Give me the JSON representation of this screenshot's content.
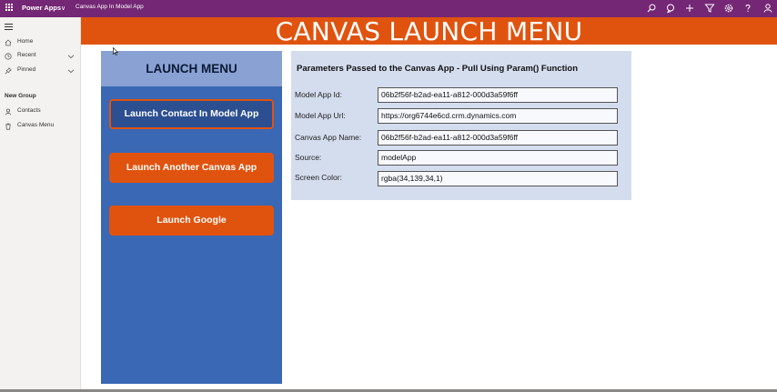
{
  "topbar": {
    "brand": "Power Apps",
    "app_name": "Canvas App In Model App",
    "icons": [
      "waffle-icon",
      "chevron-down-icon",
      "search-icon",
      "lightbulb-icon",
      "plus-icon",
      "filter-icon",
      "settings-icon",
      "help-icon",
      "person-icon"
    ]
  },
  "leftnav": {
    "items": [
      {
        "label": "Home",
        "icon": "home-icon"
      },
      {
        "label": "Recent",
        "icon": "clock-icon"
      },
      {
        "label": "Pinned",
        "icon": "pin-icon"
      }
    ],
    "group_label": "New Group",
    "group_items": [
      {
        "label": "Contacts",
        "icon": "person-icon"
      },
      {
        "label": "Canvas Menu",
        "icon": "trash-icon"
      }
    ]
  },
  "banner": {
    "title": "CANVAS LAUNCH MENU"
  },
  "launch_menu": {
    "title": "LAUNCH MENU",
    "buttons": [
      {
        "label": "Launch Contact In Model App"
      },
      {
        "label": "Launch Another Canvas App"
      },
      {
        "label": "Launch Google"
      }
    ]
  },
  "parameters": {
    "title": "Parameters Passed to the Canvas App - Pull Using Param() Function",
    "rows": [
      {
        "label": "Model App Id:",
        "value": "06b2f56f-b2ad-ea11-a812-000d3a59f6ff"
      },
      {
        "label": "Model App Url:",
        "value": "https://org6744e6cd.crm.dynamics.com"
      },
      {
        "label": "Canvas App Name:",
        "value": "06b2f56f-b2ad-ea11-a812-000d3a59f6ff"
      },
      {
        "label": "Source:",
        "value": "modelApp"
      },
      {
        "label": "Screen Color:",
        "value": "rgba(34,139,34,1)"
      }
    ]
  },
  "colors": {
    "topbar": "#742774",
    "banner": "#e0530f",
    "menu_panel": "#3a68b4",
    "menu_header": "#8aa1d4",
    "button": "#e0530f",
    "params_panel": "#d4ddee"
  }
}
